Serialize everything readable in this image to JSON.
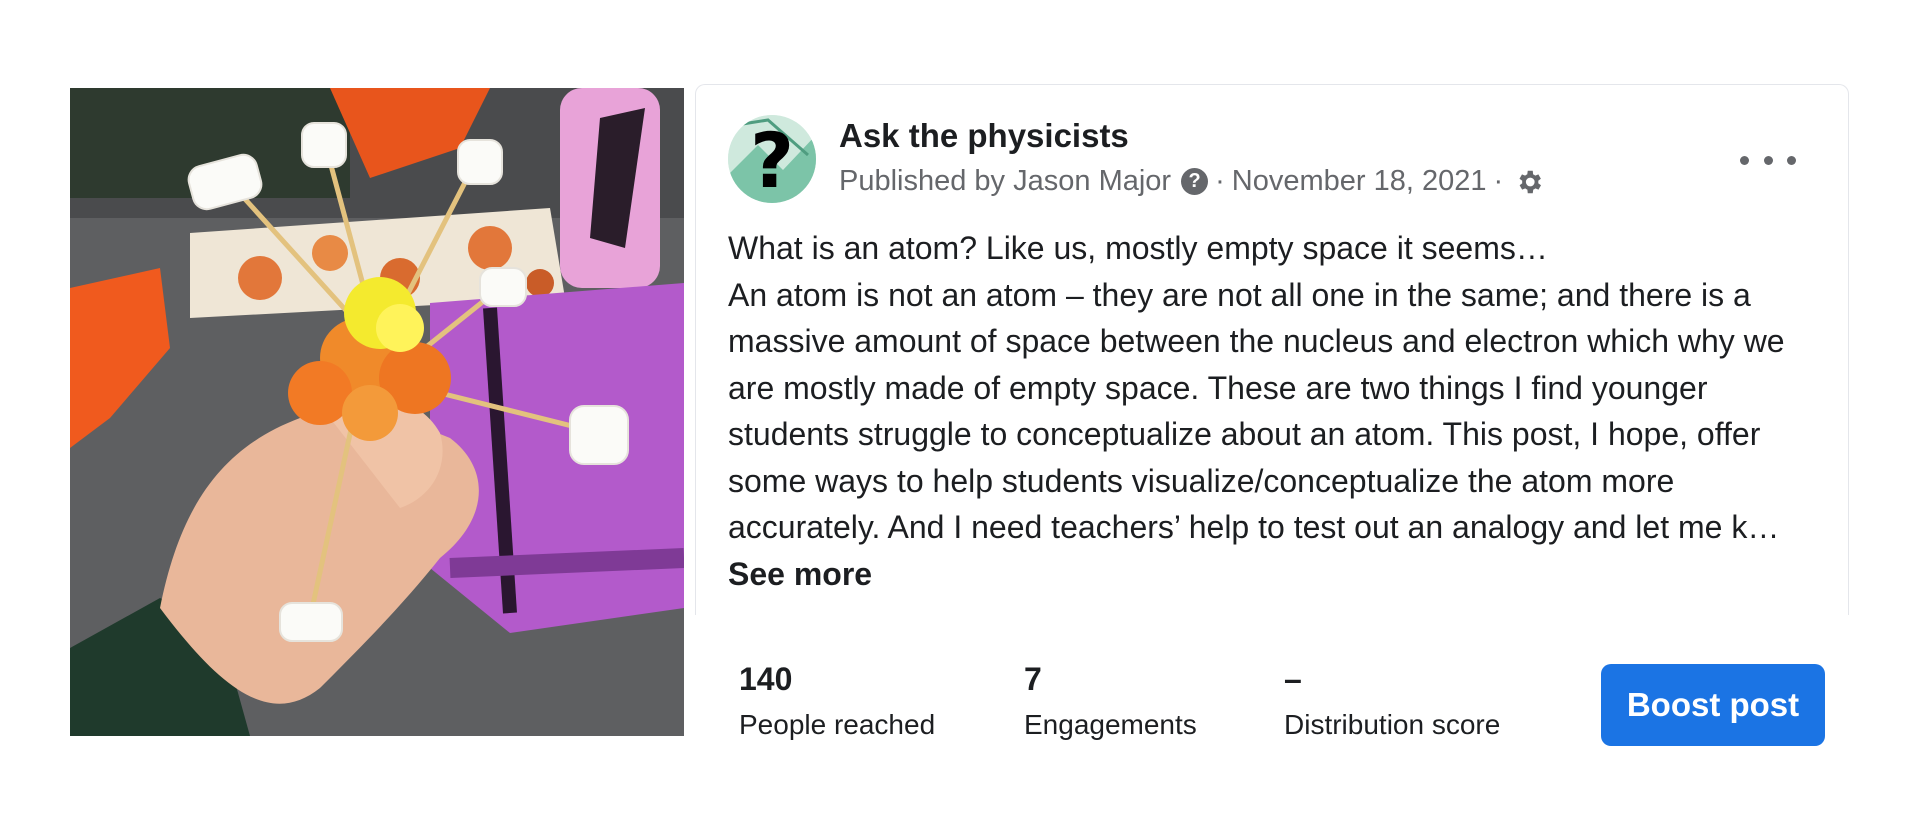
{
  "post": {
    "page_name": "Ask the physicists",
    "published_prefix": "Published by",
    "author": "Jason Major",
    "separator": "·",
    "date": "November 18, 2021",
    "text_line1": "What is an atom? Like us, mostly empty space it seems…",
    "text_body": "An atom is not an atom – they are not all one in the same; and there is a massive amount of space between the nucleus and electron which why we are mostly made of empty space. These are two things I find younger students struggle to conceptualize about an atom. This post, I hope, offer some ways to help students visualize/conceptualize the atom more accurately. And I need teachers’ help to test out an analogy and let me k…",
    "see_more_label": "See more"
  },
  "stats": {
    "reach_value": "140",
    "reach_label": "People reached",
    "engagements_value": "7",
    "engagements_label": "Engagements",
    "distribution_value": "–",
    "distribution_label": "Distribution score"
  },
  "actions": {
    "boost_label": "Boost post"
  },
  "icons": {
    "help": "question-circle-icon",
    "settings": "gear-icon",
    "more": "more-horizontal-icon"
  },
  "colors": {
    "brand_blue": "#1b74e4",
    "secondary_text": "#65676b",
    "primary_text": "#1c1e21"
  }
}
